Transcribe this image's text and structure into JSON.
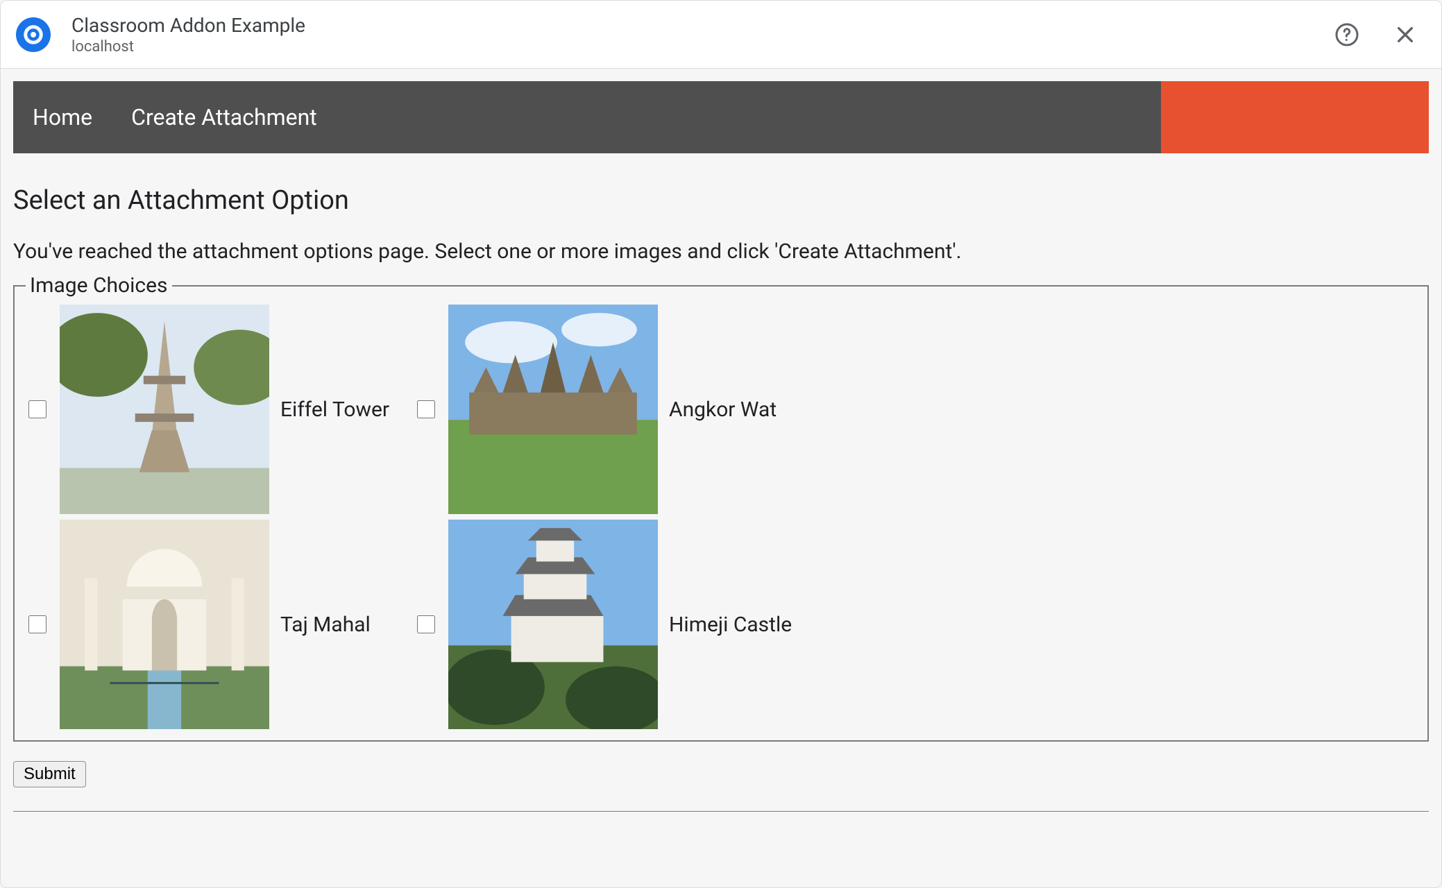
{
  "header": {
    "title": "Classroom Addon Example",
    "subtitle": "localhost"
  },
  "nav": {
    "home_label": "Home",
    "create_label": "Create Attachment"
  },
  "page": {
    "heading": "Select an Attachment Option",
    "intro": "You've reached the attachment options page. Select one or more images and click 'Create Attachment'.",
    "legend": "Image Choices",
    "submit_label": "Submit"
  },
  "choices": [
    {
      "label": "Eiffel Tower"
    },
    {
      "label": "Angkor Wat"
    },
    {
      "label": "Taj Mahal"
    },
    {
      "label": "Himeji Castle"
    }
  ]
}
